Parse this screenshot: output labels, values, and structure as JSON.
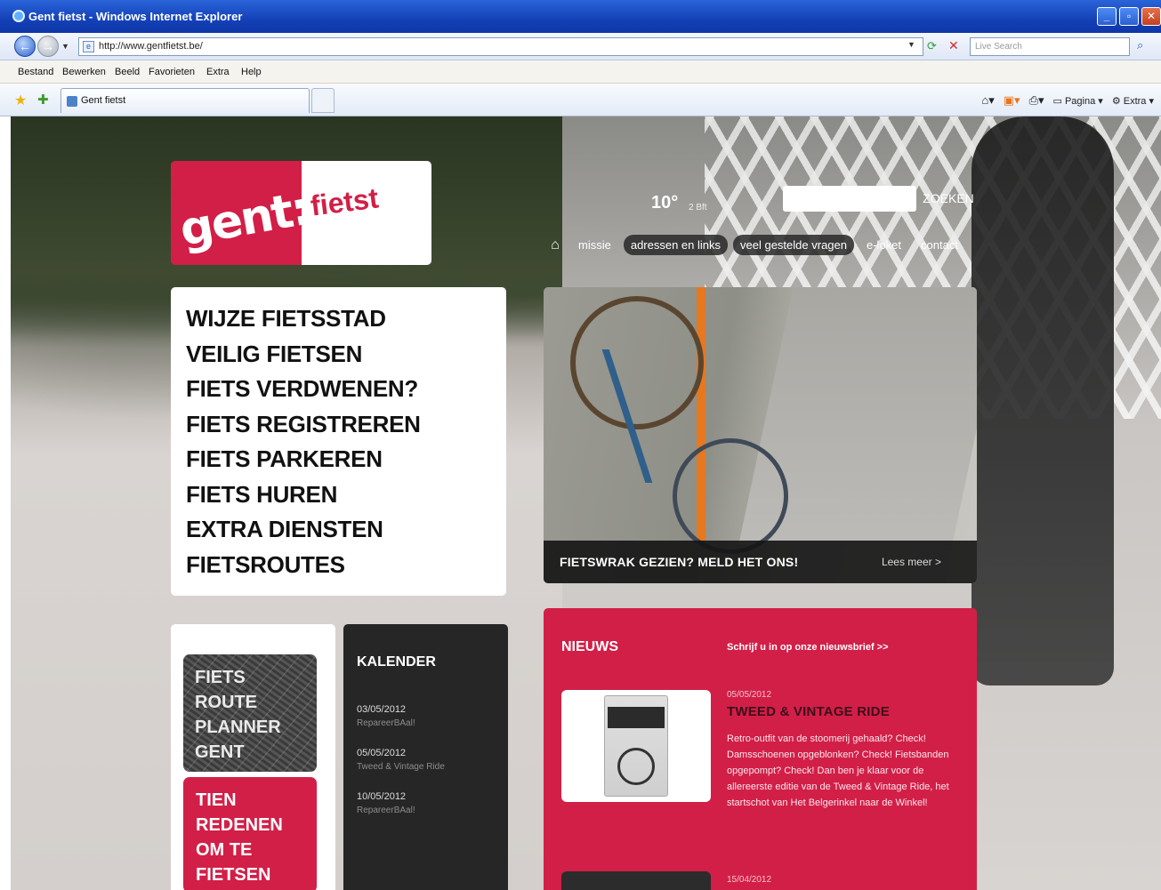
{
  "browser": {
    "window_title": "Gent fietst - Windows Internet Explorer",
    "url": "http://www.gentfietst.be/",
    "search_placeholder": "Live Search",
    "menu": [
      "Bestand",
      "Bewerken",
      "Beeld",
      "Favorieten",
      "Extra",
      "Help"
    ],
    "tab_title": "Gent fietst",
    "commands": {
      "page": "Pagina",
      "tools": "Extra"
    }
  },
  "site": {
    "logo": {
      "left": "gent:",
      "right": "fietst"
    },
    "weather": {
      "temp": "10°",
      "sub": "2 Bft"
    },
    "search_button": "ZOEKEN",
    "nav": [
      "missie",
      "adressen en links",
      "veel gestelde vragen",
      "e-loket",
      "contact"
    ],
    "menu": [
      "WIJZE FIETSSTAD",
      "VEILIG FIETSEN",
      "FIETS VERDWENEN?",
      "FIETS REGISTREREN",
      "FIETS PARKEREN",
      "FIETS HUREN",
      "EXTRA DIENSTEN",
      "FIETSROUTES"
    ],
    "feature": {
      "caption": "FIETSWRAK GEZIEN? MELD HET ONS!",
      "more": "Lees meer >"
    },
    "route_planner": [
      "FIETS",
      "ROUTE",
      "PLANNER",
      "GENT"
    ],
    "reasons": [
      "TIEN",
      "REDENEN",
      "OM TE",
      "FIETSEN"
    ],
    "calendar": {
      "title": "KALENDER",
      "entries": [
        {
          "date": "03/05/2012",
          "event": "RepareerBAal!"
        },
        {
          "date": "05/05/2012",
          "event": "Tweed & Vintage Ride"
        },
        {
          "date": "10/05/2012",
          "event": "RepareerBAal!"
        }
      ]
    },
    "news": {
      "title": "NIEUWS",
      "subscribe": "Schrijf u in op onze nieuwsbrief >>",
      "items": [
        {
          "date": "05/05/2012",
          "headline": "TWEED & VINTAGE RIDE",
          "body": "Retro-outfit van de stoomerij gehaald? Check! Damsschoenen opgeblonken? Check! Fietsbanden opgepompt? Check! Dan ben je klaar voor de allereerste editie van de Tweed & Vintage Ride, het startschot van Het Belgerinkel naar de Winkel!"
        },
        {
          "date": "15/04/2012"
        }
      ]
    },
    "colors": {
      "brand_red": "#d21f47",
      "dark": "#262626"
    }
  }
}
